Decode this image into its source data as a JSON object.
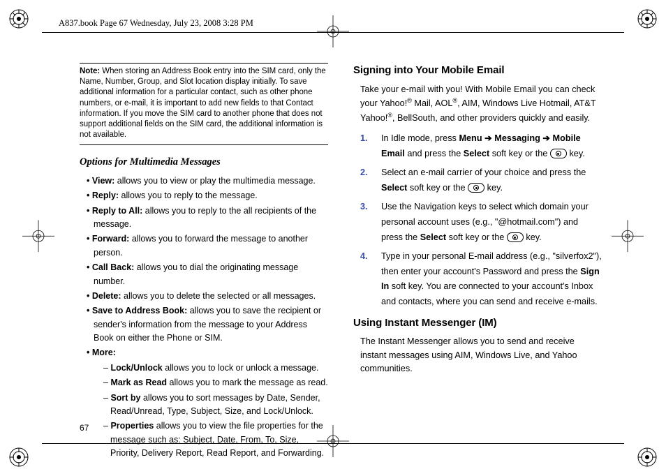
{
  "header": "A837.book  Page 67  Wednesday, July 23, 2008  3:28 PM",
  "page_number": "67",
  "left": {
    "note_label": "Note:",
    "note_text": " When storing an Address Book entry into the SIM card, only the Name, Number, Group, and Slot location display initially. To save additional information for a particular contact, such as other phone numbers, or e-mail, it is important to add new fields to that Contact information. If you move the SIM card to another phone that does not support additional fields on the SIM card, the additional information is not available.",
    "sub_heading": "Options for Multimedia Messages",
    "bullets": {
      "view_b": "View:",
      "view_t": " allows you to view or play the multimedia message.",
      "reply_b": "Reply:",
      "reply_t": " allows you to reply to the message.",
      "replyall_b": "Reply to All:",
      "replyall_t": " allows you to reply to the all recipients of the message.",
      "forward_b": "Forward:",
      "forward_t": " allows you to forward the message to another person.",
      "callback_b": "Call Back:",
      "callback_t": " allows you to dial the originating message number.",
      "delete_b": "Delete:",
      "delete_t": " allows you to delete the selected or all messages.",
      "save_b": "Save to Address Book:",
      "save_t": " allows you to save the recipient or sender's information from the message to your Address Book on either the Phone or SIM.",
      "more_b": "More:",
      "sub": {
        "lock_b": "Lock/Unlock",
        "lock_t": " allows you to lock or unlock a message.",
        "mark_b": "Mark as Read",
        "mark_t": " allows you to mark the message as read.",
        "sort_b": "Sort by",
        "sort_t": " allows you to sort messages by Date, Sender, Read/Unread, Type, Subject, Size, and Lock/Unlock.",
        "prop_b": "Properties",
        "prop_t": " allows you to view the file properties for the message such as: Subject, Date, From, To, Size, Priority, Delivery Report, Read Report, and Forwarding."
      }
    }
  },
  "right": {
    "h1": "Signing into Your Mobile Email",
    "p1a": "Take your e-mail with you! With Mobile Email you can check your Yahoo!",
    "p1b": " Mail, AOL",
    "p1c": ", AIM, Windows Live Hotmail, AT&T Yahoo!",
    "p1d": ", BellSouth, and other providers quickly and easily.",
    "steps": {
      "s1a": "In Idle mode, press ",
      "s1_menu": "Menu",
      "s1_arrow": " ➔ ",
      "s1_msg": "Messaging",
      "s1_me": "Mobile Email",
      "s1b": " and press the ",
      "s1_sel": "Select",
      "s1c": " soft key or the ",
      "s1d": " key.",
      "s2a": "Select an e-mail carrier of your choice and press the ",
      "s2_sel": "Select",
      "s2b": " soft key or the ",
      "s2c": " key.",
      "s3a": "Use the Navigation keys to select which domain your personal account uses (e.g., \"@hotmail.com\") and press the ",
      "s3_sel": "Select",
      "s3b": " soft key or the ",
      "s3c": " key.",
      "s4a": "Type in your personal E-mail address (e.g., \"silverfox2\"), then enter your account's Password and press the ",
      "s4_sign": "Sign In",
      "s4b": " soft key. You are connected to your account's Inbox and contacts, where you can send and receive e-mails."
    },
    "h2": "Using Instant Messenger (IM)",
    "p2": "The Instant Messenger allows you to send and receive instant messages using AIM, Windows Live, and Yahoo communities."
  }
}
